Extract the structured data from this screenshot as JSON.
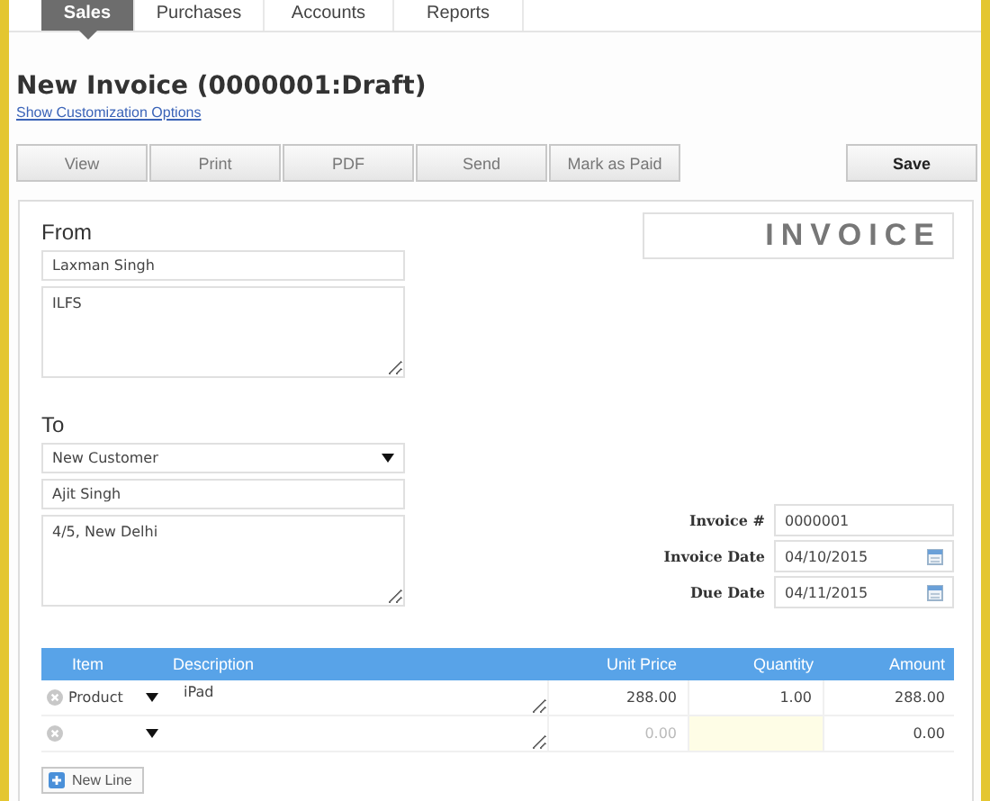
{
  "tabs": [
    {
      "label": "Sales",
      "selected": true
    },
    {
      "label": "Purchases",
      "selected": false
    },
    {
      "label": "Accounts",
      "selected": false
    },
    {
      "label": "Reports",
      "selected": false
    }
  ],
  "page": {
    "title": "New Invoice (0000001:Draft)",
    "link": "Show Customization Options"
  },
  "toolbar": {
    "actions": [
      "View",
      "Print",
      "PDF",
      "Send",
      "Mark as Paid"
    ],
    "save": "Save"
  },
  "from": {
    "label": "From",
    "name": "Laxman Singh",
    "address": "ILFS"
  },
  "to": {
    "label": "To",
    "customer_select": "New Customer",
    "name": "Ajit Singh",
    "address": "4/5, New Delhi"
  },
  "doc_title": "INVOICE",
  "details": [
    {
      "label": "Invoice #",
      "value": "0000001",
      "kind": "text"
    },
    {
      "label": "Invoice Date",
      "value": "04/10/2015",
      "kind": "date"
    },
    {
      "label": "Due Date",
      "value": "04/11/2015",
      "kind": "date"
    }
  ],
  "table": {
    "columns": [
      "Item",
      "Description",
      "Unit Price",
      "Quantity",
      "Amount"
    ],
    "rows": [
      {
        "item": "Product",
        "description": "iPad",
        "unit_price": "288.00",
        "quantity": "1.00",
        "amount": "288.00",
        "quantity_highlighted": false
      },
      {
        "unit_price_placeholder": "0.00",
        "amount": "0.00",
        "quantity_highlighted": true
      }
    ]
  },
  "new_line_button": "New Line"
}
